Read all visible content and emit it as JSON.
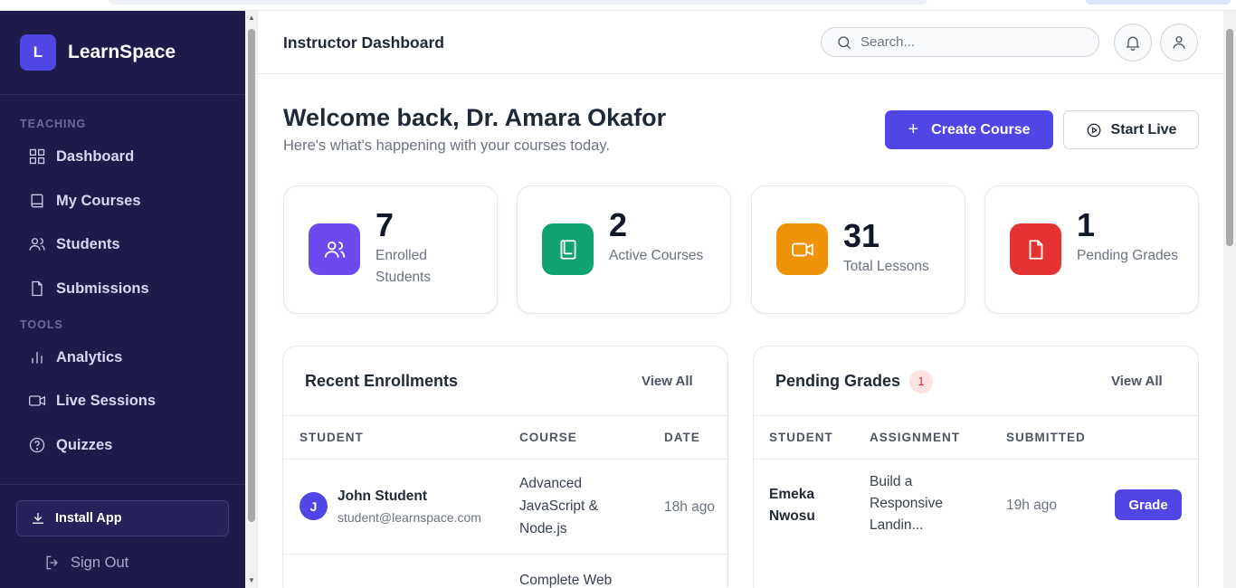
{
  "brand": {
    "logo_letter": "L",
    "name": "LearnSpace"
  },
  "sidebar": {
    "section_teaching": "TEACHING",
    "section_tools": "TOOLS",
    "items": [
      {
        "label": "Dashboard",
        "icon": "grid-icon"
      },
      {
        "label": "My Courses",
        "icon": "book-icon"
      },
      {
        "label": "Students",
        "icon": "users-icon"
      },
      {
        "label": "Submissions",
        "icon": "file-icon"
      },
      {
        "label": "Analytics",
        "icon": "bar-chart-icon"
      },
      {
        "label": "Live Sessions",
        "icon": "video-icon"
      },
      {
        "label": "Quizzes",
        "icon": "help-circle-icon"
      }
    ],
    "install_label": "Install App",
    "signout_label": "Sign Out"
  },
  "header": {
    "title": "Instructor Dashboard",
    "search_placeholder": "Search..."
  },
  "main": {
    "welcome": "Welcome back, Dr. Amara Okafor",
    "subtitle": "Here's what's happening with your courses today.",
    "create_course_label": "Create Course",
    "start_live_label": "Start Live"
  },
  "stats": [
    {
      "value": "7",
      "label": "Enrolled Students",
      "color": "#6d4aed"
    },
    {
      "value": "2",
      "label": "Active Courses",
      "color": "#10a36f"
    },
    {
      "value": "31",
      "label": "Total Lessons",
      "color": "#ee9209"
    },
    {
      "value": "1",
      "label": "Pending Grades",
      "color": "#e53333"
    }
  ],
  "recent_enrollments": {
    "title": "Recent Enrollments",
    "view_all": "View All",
    "columns": [
      "STUDENT",
      "COURSE",
      "DATE"
    ],
    "rows": [
      {
        "initial": "J",
        "name": "John Student",
        "email": "student@learnspace.com",
        "course": "Advanced JavaScript & Node.js",
        "date": "18h ago"
      },
      {
        "initial": "",
        "name": "",
        "email": "",
        "course": "Complete Web",
        "date": ""
      }
    ]
  },
  "pending_grades": {
    "title": "Pending Grades",
    "count": "1",
    "view_all": "View All",
    "columns": [
      "STUDENT",
      "ASSIGNMENT",
      "SUBMITTED"
    ],
    "rows": [
      {
        "student": "Emeka Nwosu",
        "assignment": "Build a Responsive Landin...",
        "submitted": "19h ago",
        "action": "Grade"
      }
    ]
  }
}
